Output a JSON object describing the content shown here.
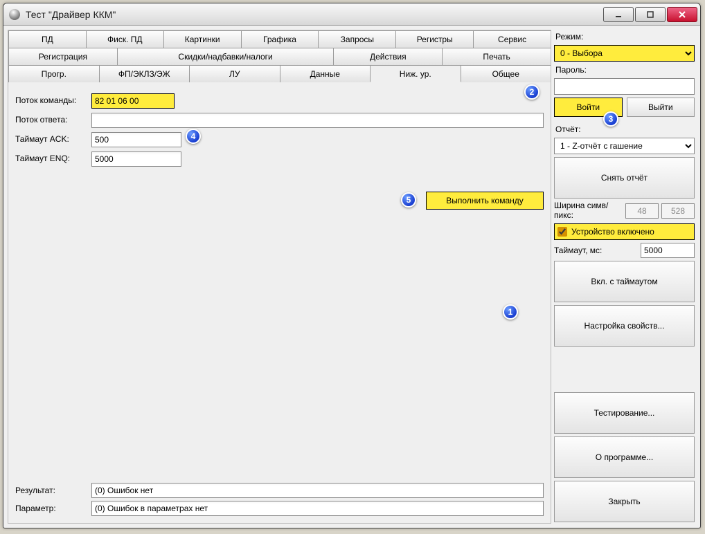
{
  "window": {
    "title": "Тест \"Драйвер ККМ\""
  },
  "tabs_row1": [
    "ПД",
    "Фиск. ПД",
    "Картинки",
    "Графика",
    "Запросы",
    "Регистры",
    "Сервис"
  ],
  "tabs_row2": [
    "Регистрация",
    "Скидки/надбавки/налоги",
    "Действия",
    "Печать"
  ],
  "tabs_row3": [
    "Прогр.",
    "ФП/ЭКЛЗ/ЭЖ",
    "ЛУ",
    "Данные",
    "Ниж. ур.",
    "Общее"
  ],
  "tabs_active": "Ниж. ур.",
  "form": {
    "cmd_stream_label": "Поток команды:",
    "cmd_stream_value": "82 01 06 00",
    "resp_stream_label": "Поток ответа:",
    "resp_stream_value": "",
    "ack_timeout_label": "Таймаут ACK:",
    "ack_timeout_value": "500",
    "enq_timeout_label": "Таймаут ENQ:",
    "enq_timeout_value": "5000"
  },
  "execute_button": "Выполнить команду",
  "result": {
    "result_label": "Результат:",
    "result_value": "(0) Ошибок нет",
    "param_label": "Параметр:",
    "param_value": "(0) Ошибок в параметрах нет"
  },
  "right": {
    "mode_label": "Режим:",
    "mode_value": "0 - Выбора",
    "password_label": "Пароль:",
    "password_value": "",
    "login_btn": "Войти",
    "logout_btn": "Выйти",
    "report_label": "Отчёт:",
    "report_value": "1 - Z-отчёт с гашение",
    "take_report_btn": "Снять отчёт",
    "width_label": "Ширина симв/пикс:",
    "width_chars": "48",
    "width_pixels": "528",
    "device_on_label": "Устройство включено",
    "device_on_checked": true,
    "timeout_label": "Таймаут, мс:",
    "timeout_value": "5000",
    "on_with_timeout_btn": "Вкл. с таймаутом",
    "settings_btn": "Настройка свойств...",
    "test_btn": "Тестирование...",
    "about_btn": "О программе...",
    "close_btn": "Закрыть"
  },
  "callouts": [
    "1",
    "2",
    "3",
    "4",
    "5"
  ],
  "highlight_color": "#ffec3d"
}
